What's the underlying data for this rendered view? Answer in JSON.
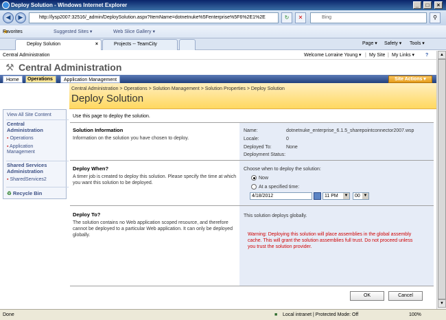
{
  "window": {
    "title": "Deploy Solution - Windows Internet Explorer"
  },
  "browser": {
    "address": "http://lysp2007:32516/_admin/DeploySolution.aspx?ItemName=dotnetnuke%5Fenterprise%5F6%2E1%2E",
    "search_placeholder": "Bing",
    "favorites_label": "Favorites",
    "favbar_items": [
      "Suggested Sites ▾",
      "Web Slice Gallery ▾"
    ],
    "tabs": [
      "Deploy Solution",
      "Projects -- TeamCity"
    ],
    "commands": [
      "Page ▾",
      "Safety ▾",
      "Tools ▾"
    ]
  },
  "sharepoint": {
    "top_left": "Central Administration",
    "welcome": "Welcome Lorraine Young ▾",
    "my_site": "My Site",
    "my_links": "My Links ▾",
    "site_title": "Central Administration",
    "tabs": [
      "Home",
      "Operations",
      "Application Management"
    ],
    "site_actions": "Site Actions ▾"
  },
  "page": {
    "breadcrumb": "Central Administration > Operations > Solution Management > Solution Properties > Deploy Solution",
    "title": "Deploy Solution",
    "intro": "Use this page to deploy the solution."
  },
  "nav": {
    "view_all": "View All Site Content",
    "central_admin": "Central Administration",
    "operations": "Operations",
    "application_management": "Application Management",
    "ssp_header": "Shared Services Administration",
    "ssp_item": "SharedServices2",
    "recycle_bin": "Recycle Bin"
  },
  "sections": {
    "info": {
      "title": "Solution Information",
      "desc": "Information on the solution you have chosen to deploy.",
      "name_label": "Name:",
      "name_value": "dotnetnuke_enterprise_6.1.5_sharepointconnector2007.wsp",
      "locale_label": "Locale:",
      "locale_value": "0",
      "deployed_label": "Deployed To:",
      "deployed_value": "None",
      "status_label": "Deployment Status:"
    },
    "when": {
      "title": "Deploy When?",
      "desc": "A timer job is created to deploy this solution. Please specify the time at which you want this solution to be deployed.",
      "prompt": "Choose when to deploy the solution:",
      "now": "Now",
      "specified": "At a specified time:",
      "date": "4/18/2012",
      "hour": "11 PM",
      "minute": "00"
    },
    "to": {
      "title": "Deploy To?",
      "desc": "The solution contains no Web application scoped resource, and therefore cannot be deployed to a particular Web application. It can only be deployed globally.",
      "globally": "This solution deploys globally.",
      "warning": "Warning: Deploying this solution will place assemblies in the global assembly cache. This will grant the solution assemblies full trust. Do not proceed unless you trust the solution provider."
    }
  },
  "buttons": {
    "ok": "OK",
    "cancel": "Cancel"
  },
  "status": {
    "left": "Done",
    "zone": "Local intranet | Protected Mode: Off",
    "zoom": "100%"
  }
}
